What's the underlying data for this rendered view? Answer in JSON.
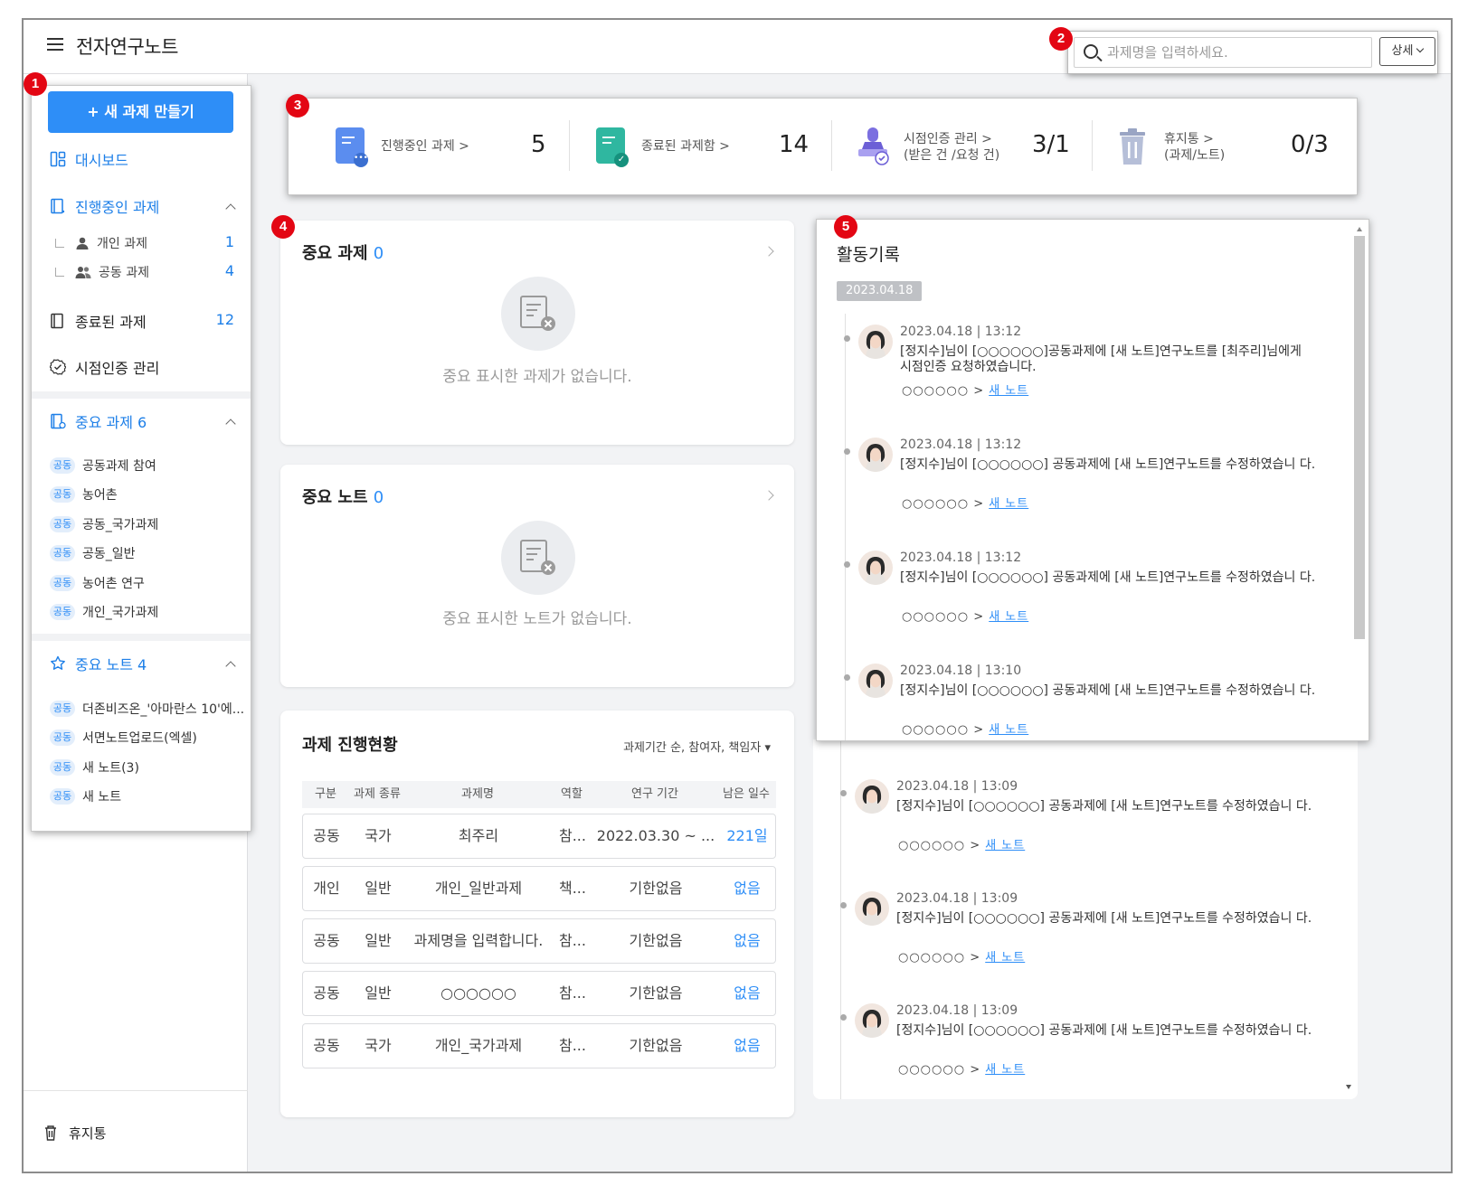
{
  "app": {
    "title": "전자연구노트"
  },
  "search": {
    "placeholder": "과제명을 입력하세요.",
    "detail_label": "상세"
  },
  "markers": [
    "1",
    "2",
    "3",
    "4",
    "5"
  ],
  "sidebar": {
    "new_button": "+ 새 과제 만들기",
    "dashboard": "대시보드",
    "ongoing": {
      "label": "진행중인 과제",
      "sub": [
        {
          "label": "개인 과제",
          "count": "1"
        },
        {
          "label": "공동 과제",
          "count": "4"
        }
      ]
    },
    "finished": {
      "label": "종료된 과제",
      "count": "12"
    },
    "timestamp": {
      "label": "시점인증 관리"
    },
    "fav_tasks": {
      "label": "중요 과제 6",
      "items": [
        {
          "tag": "공동",
          "label": "공동과제 참여"
        },
        {
          "tag": "공동",
          "label": "농어촌"
        },
        {
          "tag": "공동",
          "label": "공동_국가과제"
        },
        {
          "tag": "공동",
          "label": "공동_일반"
        },
        {
          "tag": "공동",
          "label": "농어촌 연구"
        },
        {
          "tag": "공동",
          "label": "개인_국가과제"
        }
      ]
    },
    "fav_notes": {
      "label": "중요 노트 4",
      "items": [
        {
          "tag": "공동",
          "label": "더존비즈온_'아마란스 10'에..."
        },
        {
          "tag": "공동",
          "label": "서면노트업로드(엑셀)"
        },
        {
          "tag": "공동",
          "label": "새 노트(3)"
        },
        {
          "tag": "공동",
          "label": "새 노트"
        }
      ]
    },
    "trash": "휴지통"
  },
  "stats": [
    {
      "label": "진행중인 과제 >",
      "value": "5"
    },
    {
      "label": "종료된 과제함 >",
      "value": "14"
    },
    {
      "label": "시점인증 관리 >",
      "label2": "(받은 건 /요청 건)",
      "value": "3/1"
    },
    {
      "label": "휴지통 >",
      "label2": "(과제/노트)",
      "value": "0/3"
    }
  ],
  "important_tasks": {
    "title": "중요 과제",
    "count": "0",
    "empty": "중요 표시한 과제가 없습니다."
  },
  "important_notes": {
    "title": "중요 노트",
    "count": "0",
    "empty": "중요 표시한 노트가 없습니다."
  },
  "progress": {
    "title": "과제 진행현황",
    "sort": "과제기간 순, 참여자, 책임자",
    "columns": [
      "구분",
      "과제 종류",
      "과제명",
      "역할",
      "연구 기간",
      "남은 일수"
    ],
    "rows": [
      [
        "공동",
        "국가",
        "최주리",
        "참...",
        "2022.03.30 ~ ...",
        "221일"
      ],
      [
        "개인",
        "일반",
        "개인_일반과제",
        "책...",
        "기한없음",
        "없음"
      ],
      [
        "공동",
        "일반",
        "과제명을 입력합니다.",
        "참...",
        "기한없음",
        "없음"
      ],
      [
        "공동",
        "일반",
        "○○○○○○",
        "참...",
        "기한없음",
        "없음"
      ],
      [
        "공동",
        "국가",
        "개인_국가과제",
        "참...",
        "기한없음",
        "없음"
      ]
    ]
  },
  "activity": {
    "title": "활동기록",
    "date": "2023.04.18",
    "entries": [
      {
        "time": "2023.04.18 | 13:12",
        "text": "[정지수]님이 [○○○○○○]공동과제에 [새 노트]연구노트를 [최주리]님에게 시점인증 요청하였습니다.",
        "path": "○○○○○○ > ",
        "note": "새 노트"
      },
      {
        "time": "2023.04.18 | 13:12",
        "text": "[정지수]님이 [○○○○○○] 공동과제에 [새 노트]연구노트를 수정하였습니 다.",
        "path": "○○○○○○ > ",
        "note": "새 노트"
      },
      {
        "time": "2023.04.18 | 13:12",
        "text": "[정지수]님이 [○○○○○○] 공동과제에 [새 노트]연구노트를 수정하였습니 다.",
        "path": "○○○○○○ > ",
        "note": "새 노트"
      },
      {
        "time": "2023.04.18 | 13:10",
        "text": "[정지수]님이 [○○○○○○] 공동과제에 [새 노트]연구노트를 수정하였습니 다.",
        "path": "○○○○○○ > ",
        "note": "새 노트"
      },
      {
        "time": "2023.04.18 | 13:09",
        "text": "[정지수]님이 [○○○○○○] 공동과제에 [새 노트]연구노트를 수정하였습니 다.",
        "path": "○○○○○○ > ",
        "note": "새 노트"
      },
      {
        "time": "2023.04.18 | 13:09",
        "text": "[정지수]님이 [○○○○○○] 공동과제에 [새 노트]연구노트를 수정하였습니 다.",
        "path": "○○○○○○ > ",
        "note": "새 노트"
      },
      {
        "time": "2023.04.18 | 13:09",
        "text": "[정지수]님이 [○○○○○○] 공동과제에 [새 노트]연구노트를 수정하였습니 다.",
        "path": "○○○○○○ > ",
        "note": "새 노트"
      }
    ]
  },
  "colors": {
    "accent": "#2e8ef7",
    "marker": "#e30613",
    "tag_bg": "#e3eefb"
  }
}
